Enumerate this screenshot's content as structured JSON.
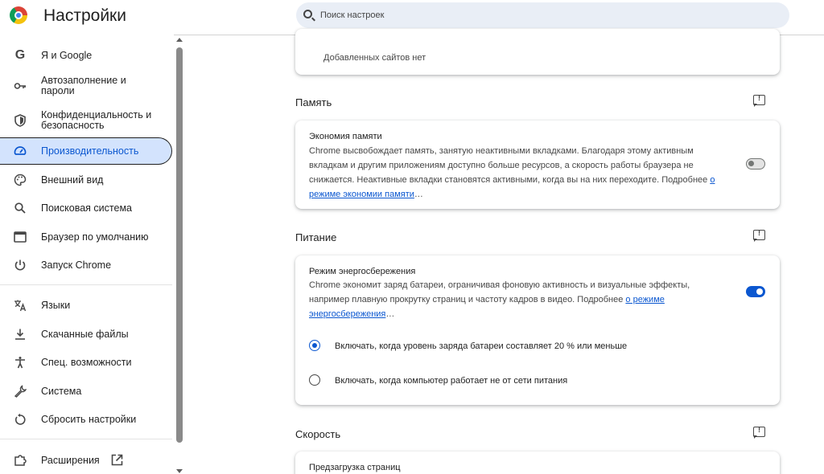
{
  "header": {
    "title": "Настройки",
    "search_placeholder": "Поиск настроек"
  },
  "sidebar": {
    "items": [
      {
        "label": "Я и Google",
        "icon": "google-g-icon"
      },
      {
        "label": "Автозаполнение и пароли",
        "icon": "key-icon"
      },
      {
        "label": "Конфиденциальность и безопасность",
        "icon": "shield-icon"
      },
      {
        "label": "Производительность",
        "icon": "speedometer-icon",
        "active": true
      },
      {
        "label": "Внешний вид",
        "icon": "palette-icon"
      },
      {
        "label": "Поисковая система",
        "icon": "search-icon"
      },
      {
        "label": "Браузер по умолчанию",
        "icon": "browser-window-icon"
      },
      {
        "label": "Запуск Chrome",
        "icon": "power-icon"
      },
      {
        "label": "Языки",
        "icon": "translate-icon"
      },
      {
        "label": "Скачанные файлы",
        "icon": "download-icon"
      },
      {
        "label": "Спец. возможности",
        "icon": "accessibility-icon"
      },
      {
        "label": "Система",
        "icon": "wrench-icon"
      },
      {
        "label": "Сбросить настройки",
        "icon": "reset-icon"
      },
      {
        "label": "Расширения",
        "icon": "puzzle-icon"
      }
    ]
  },
  "main": {
    "top_card_text": "Добавленных сайтов нет",
    "memory": {
      "section_title": "Память",
      "title": "Экономия памяти",
      "desc_line1": "Chrome высвобождает память, занятую неактивными вкладками. Благодаря этому активным",
      "desc_line2": "вкладкам и другим приложениям доступно больше ресурсов, а скорость работы браузера не",
      "desc_line3": "снижается. Неактивные вкладки становятся активными, когда вы на них переходите. Подробнее ",
      "link_part1": "о",
      "link_part2": "режиме экономии памяти",
      "ellipsis": "…",
      "enabled": false
    },
    "power": {
      "section_title": "Питание",
      "title": "Режим энергосбережения",
      "desc_line1": "Chrome экономит заряд батареи, ограничивая фоновую активность и визуальные эффекты,",
      "desc_line2": "например плавную прокрутку страниц и частоту кадров в видео. Подробнее ",
      "link_part1": "о режиме",
      "link_part2": "энергосбережения",
      "ellipsis": "…",
      "enabled": true,
      "option1": "Включать, когда уровень заряда батареи составляет 20 % или меньше",
      "option2": "Включать, когда компьютер работает не от сети питания",
      "selected_option": 1
    },
    "speed": {
      "section_title": "Скорость",
      "card_title": "Предзагрузка страниц"
    }
  },
  "colors": {
    "accent": "#0b57d0",
    "active_nav_bg": "#d3e3fd",
    "search_bg": "#e9eef6"
  }
}
